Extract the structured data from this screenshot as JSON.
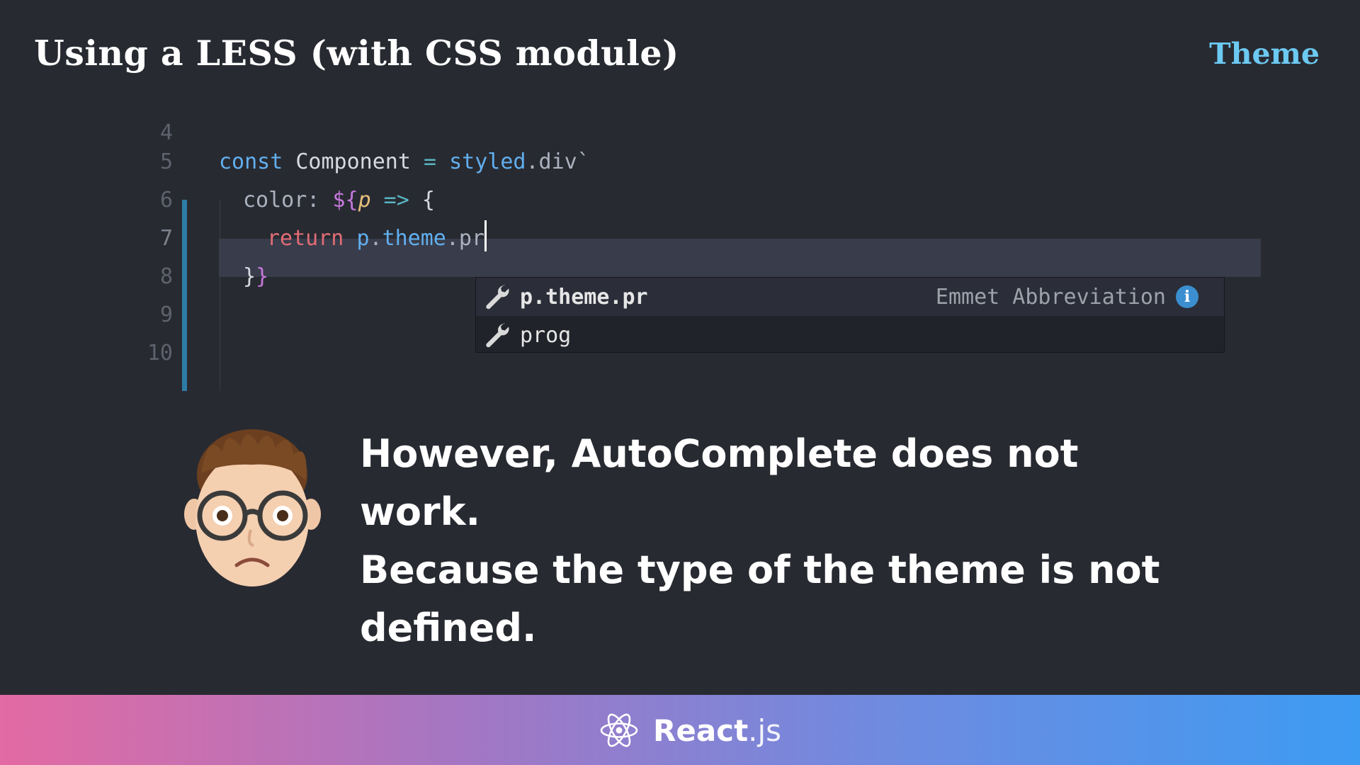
{
  "slide": {
    "title": "Using a LESS (with CSS module)",
    "tag": "Theme"
  },
  "editor": {
    "line_numbers": [
      "4",
      "5",
      "6",
      "7",
      "8",
      "9",
      "10"
    ],
    "current_line": "7",
    "lines": {
      "l5": {
        "kw": "const",
        "name": " Component ",
        "op": "=",
        "fn": " styled",
        "rest": ".div`"
      },
      "l6": {
        "prop": "color: ",
        "pun": "${",
        "param": "p",
        "arrow": " => ",
        "brace": "{"
      },
      "l7": {
        "kw": "return",
        "sp": " ",
        "obj": "p",
        "dot": ".",
        "theme": "theme",
        "rest": ".pr"
      },
      "l8": {
        "a": "}",
        "b": "}"
      }
    },
    "suggestions": [
      {
        "label": "p.theme.pr",
        "detail": "Emmet Abbreviation",
        "icon": "wrench-icon",
        "selected": true
      },
      {
        "label": "prog",
        "icon": "wrench-icon",
        "selected": false
      }
    ]
  },
  "message": {
    "line1": "However, AutoComplete does not work.",
    "line2": "Because the type of the theme is not",
    "line3": "defined."
  },
  "footer": {
    "brand_name": "React",
    "brand_suffix": ".js",
    "colors": {
      "start": "#e36aa3",
      "end": "#3d9bf2"
    }
  },
  "colors": {
    "background": "#282a31",
    "tag": "#6cc9f2",
    "gutter_mark": "#2e7ca6",
    "current_line": "#393c4a"
  }
}
